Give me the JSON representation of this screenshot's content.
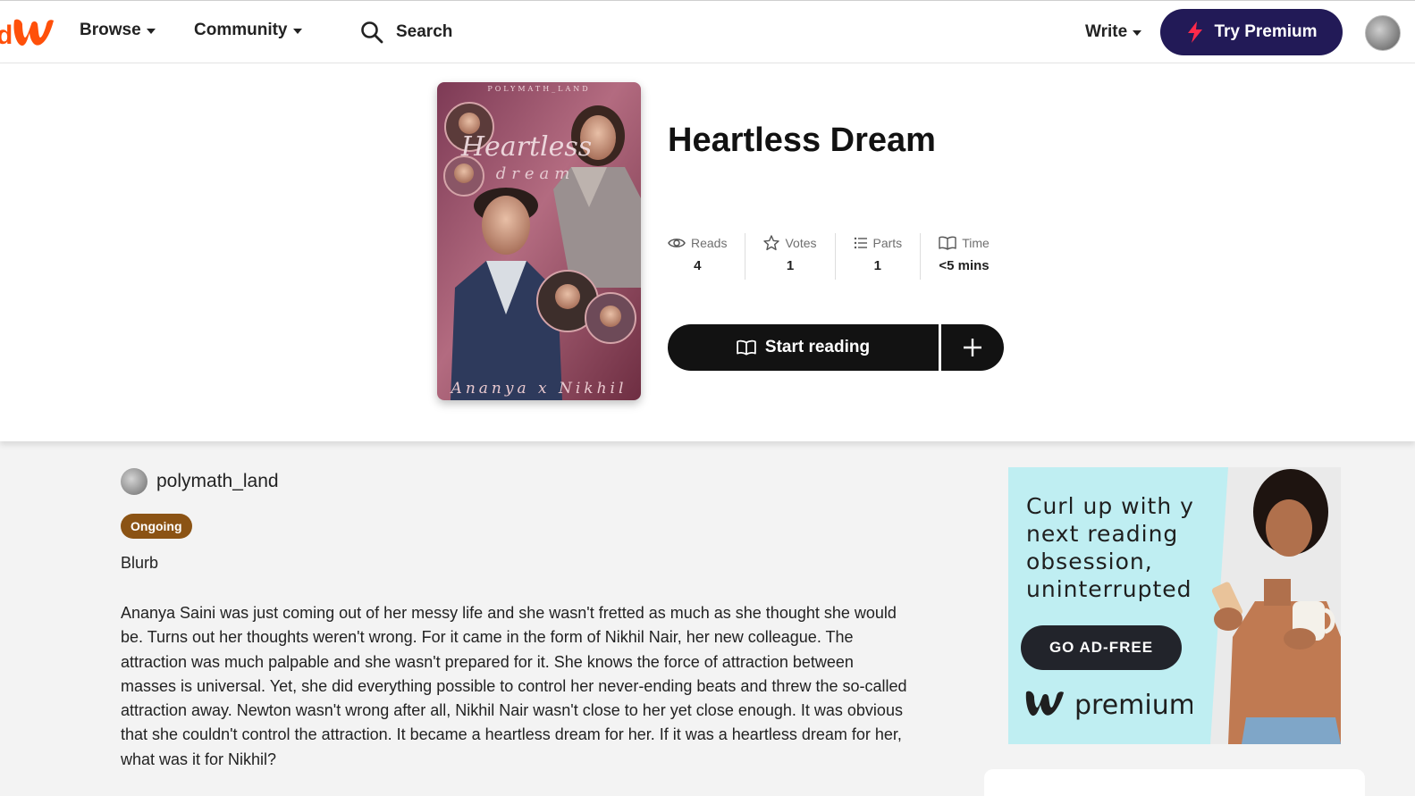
{
  "header": {
    "logo_icon": "wattpad-w-logo",
    "nav": [
      {
        "label": "Browse"
      },
      {
        "label": "Community"
      }
    ],
    "search_label": "Search",
    "write_label": "Write",
    "premium_label": "Try Premium",
    "colors": {
      "brand": "#ff500a",
      "premium_bg": "#221a57"
    }
  },
  "story": {
    "title": "Heartless Dream",
    "cover_text": {
      "top": "POLYMATH_LAND",
      "script_title": "Heartless",
      "script_sub": "dream",
      "bottom": "Ananya x Nikhil"
    },
    "stats": [
      {
        "icon": "eye-icon",
        "label": "Reads",
        "value": "4"
      },
      {
        "icon": "star-icon",
        "label": "Votes",
        "value": "1"
      },
      {
        "icon": "list-icon",
        "label": "Parts",
        "value": "1"
      },
      {
        "icon": "book-icon",
        "label": "Time",
        "value": "<5 mins"
      }
    ],
    "start_reading_label": "Start reading"
  },
  "details": {
    "author": "polymath_land",
    "status_badge": "Ongoing",
    "blurb_heading": "Blurb",
    "blurb_text": "Ananya Saini was just coming out of her messy life and she wasn't fretted as much as she thought she would be. Turns out her thoughts weren't wrong. For it came in the form of Nikhil Nair, her new colleague. The attraction was much palpable and she wasn't prepared for it. She knows the force of attraction between masses is universal. Yet, she did everything possible to control her never-ending beats and threw the so-called attraction away. Newton wasn't wrong after all, Nikhil Nair wasn't close to her yet close enough. It was obvious that she couldn't control the attraction. It became a heartless dream for her. If it was a heartless dream for her, what was it for Nikhil?"
  },
  "ad": {
    "headline": "Curl up with your next reading obsession, uninterrupted.",
    "button_label": "GO AD-FREE",
    "brand_label": "premium"
  }
}
